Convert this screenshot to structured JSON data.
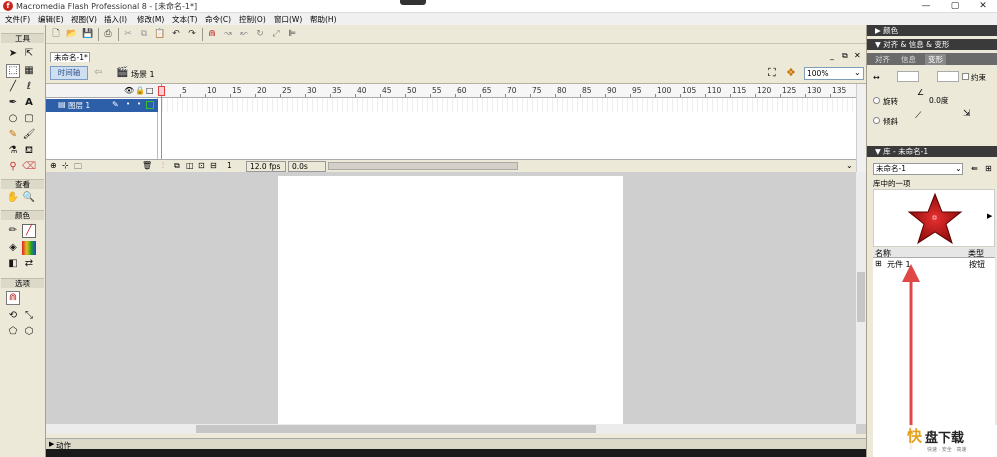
{
  "window": {
    "title": "Macromedia Flash Professional 8 - [未命名-1*]"
  },
  "menubar": {
    "items": [
      "文件(F)",
      "编辑(E)",
      "视图(V)",
      "插入(I)",
      "修改(M)",
      "文本(T)",
      "命令(C)",
      "控制(O)",
      "窗口(W)",
      "帮助(H)"
    ]
  },
  "tools": {
    "title": "工具",
    "view_label": "查看",
    "colors_label": "颜色",
    "options_label": "选项"
  },
  "document": {
    "tab_name": "未命名-1*",
    "timeline_button": "时间轴",
    "scene_name": "场景 1",
    "zoom": "100%"
  },
  "timeline": {
    "layer_name": "图层 1",
    "ruler_labels": [
      "5",
      "10",
      "15",
      "20",
      "25",
      "30",
      "35",
      "40",
      "45",
      "50",
      "55",
      "60",
      "65",
      "70",
      "75",
      "80",
      "85",
      "90",
      "95",
      "100",
      "105",
      "110",
      "115",
      "120",
      "125",
      "130",
      "135"
    ],
    "current_frame": "1",
    "fps": "12.0 fps",
    "elapsed": "0.0s"
  },
  "actions_panel": {
    "label": "动作"
  },
  "right_panel": {
    "color_title": "颜色",
    "align_title": "对齐 & 信息 & 变形",
    "align_tabs": [
      "对齐",
      "信息",
      "变形"
    ],
    "transform": {
      "constrain_label": "约束",
      "rotate_label": "旋转",
      "skew_label": "倾斜",
      "rotate_value": "0.0度"
    },
    "library_title": "库 - 未命名-1",
    "library_doc": "未命名-1",
    "library_preview_label": "库中的一项",
    "library_columns": {
      "name": "名称",
      "type": "类型"
    },
    "library_items": [
      {
        "name": "元件 1",
        "type": "按钮"
      }
    ]
  },
  "watermark": {
    "brand_char": "快",
    "name": "盘下载",
    "slogan": "快速 · 安全 · 高速"
  },
  "colors": {
    "accent_blue": "#2c5fa8",
    "star_red": "#b81414",
    "arrow_red": "#e04848"
  }
}
